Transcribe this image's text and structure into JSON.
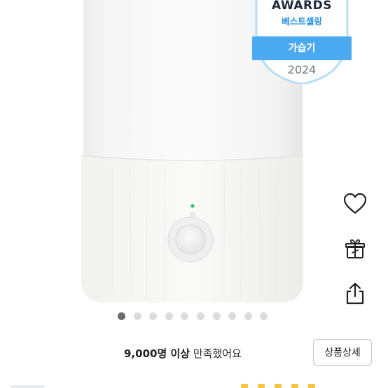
{
  "product_image": {
    "alt": "",
    "badge": {
      "title": "AWARDS",
      "subtitle": "베스트셀링",
      "category": "가습기",
      "year": "2024",
      "ribbon_color": "#4aa9ef",
      "accent_color": "#1f8fe0"
    },
    "carousel": {
      "total": 10,
      "current": 1
    }
  },
  "side_actions": [
    {
      "name": "wishlist",
      "icon": "heart-icon"
    },
    {
      "name": "gift",
      "icon": "gift-icon"
    },
    {
      "name": "share",
      "icon": "share-icon"
    }
  ],
  "summary": {
    "count_text": "9,000명 이상",
    "suffix_text": "만족했어요"
  },
  "detail_button": {
    "label": "상품상세"
  }
}
